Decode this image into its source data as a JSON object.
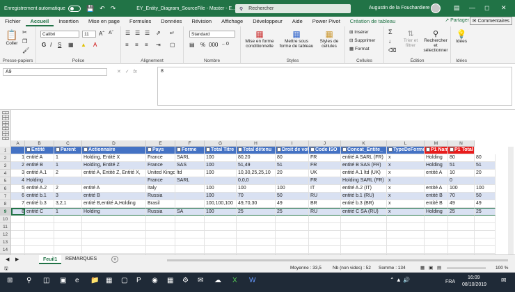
{
  "titlebar": {
    "autosave": "Enregistrement automatique",
    "doc_title": "EY_Entity_Diagram_SourceFile - Master - E...",
    "search": "Rechercher",
    "user": "Augustin de la Fouchardiere"
  },
  "menu": [
    "Fichier",
    "Accueil",
    "Insertion",
    "Mise en page",
    "Formules",
    "Données",
    "Révision",
    "Affichage",
    "Développeur",
    "Aide",
    "Power Pivot",
    "Création de tableau"
  ],
  "menu_share": "Partager",
  "menu_comments": "Commentaires",
  "ribbon": {
    "clipboard": {
      "paste": "Coller",
      "name": "Presse-papiers"
    },
    "font": {
      "family": "Calibri",
      "size": "11",
      "name": "Police"
    },
    "align": {
      "name": "Alignement"
    },
    "number": {
      "format": "Standard",
      "name": "Nombre"
    },
    "styles": {
      "cond": "Mise en forme conditionnelle",
      "table": "Mettre sous forme de tableau",
      "cell": "Styles de cellules",
      "name": "Styles"
    },
    "cells": {
      "insert": "Insérer",
      "delete": "Supprimer",
      "format": "Format",
      "name": "Cellules"
    },
    "edit": {
      "sort": "Trier et filtrer",
      "find": "Rechercher et sélectionner",
      "name": "Édition"
    },
    "ideas": {
      "label": "Idées",
      "name": "Idées"
    }
  },
  "formula": {
    "namebox": "A9",
    "value": "8"
  },
  "outline_levels": [
    "1",
    "2",
    "3",
    "4",
    "5",
    "6",
    "7",
    "8",
    "9"
  ],
  "columns": [
    "A",
    "B",
    "C",
    "D",
    "E",
    "F",
    "G",
    "H",
    "I",
    "J",
    "K",
    "L",
    "M",
    "N"
  ],
  "headers": [
    "Entité",
    "Parent",
    "Actionnaire",
    "Pays",
    "Forme",
    "Total Titre",
    "Total détenu",
    "Droit de vote",
    "Code ISO",
    "Concat_Entite_",
    "TypeDeForme",
    "P1 Nam",
    "P1 Total Déten"
  ],
  "rows": [
    [
      "1",
      "entité A",
      "1",
      "Holding, Entité X",
      "France",
      "SARL",
      "100",
      "80,20",
      "80",
      "FR",
      "entité A SARL (FR)",
      "x",
      "Holding",
      "80",
      "80"
    ],
    [
      "2",
      "entité B",
      "1",
      "Holding, Entité Z",
      "France",
      "SAS",
      "100",
      "51,49",
      "51",
      "FR",
      "entité B SAS (FR)",
      "x",
      "Holding",
      "51",
      "51"
    ],
    [
      "3",
      "entité A.1",
      "2",
      "entité A, Entité Z, Entité X,",
      "United Kingd",
      "ltd",
      "100",
      "10,30,25,25,10",
      "20",
      "UK",
      "entité A.1 ltd (UK)",
      "x",
      "entité A",
      "10",
      "20"
    ],
    [
      "4",
      "Holding",
      "",
      "",
      "France",
      "SARL",
      "",
      "0,0,0",
      "",
      "FR",
      "Holding SARL (FR)",
      "x",
      "",
      "0",
      ""
    ],
    [
      "5",
      "entité A.2",
      "2",
      "entité A",
      "Italy",
      "",
      "100",
      "100",
      "100",
      "IT",
      "entité A.2  (IT)",
      "x",
      "entité A",
      "100",
      "100"
    ],
    [
      "6",
      "entité b.1",
      "3",
      "entité B",
      "Russia",
      "",
      "100",
      "70",
      "50",
      "RU",
      "entité b.1  (RU)",
      "x",
      "entité B",
      "70",
      "50"
    ],
    [
      "7",
      "entité b.3",
      "3,2,1",
      "entité B,entité A,Holding",
      "Brasil",
      "",
      "100,100,100",
      "49,70,30",
      "49",
      "BR",
      "entité b.3  (BR)",
      "x",
      "entité B",
      "49",
      "49"
    ],
    [
      "8",
      "entité C",
      "1",
      "Holding",
      "Russia",
      "SA",
      "100",
      "25",
      "25",
      "RU",
      "entité C SA (RU)",
      "x",
      "Holding",
      "25",
      "25"
    ]
  ],
  "row_numbers": [
    "1",
    "2",
    "3",
    "4",
    "5",
    "6",
    "7",
    "8",
    "9",
    "10",
    "11",
    "12",
    "13",
    "14",
    "15",
    "16",
    "17",
    "18"
  ],
  "sheets": {
    "active": "Feuil1",
    "other": "REMARQUES",
    "add": "+"
  },
  "status": {
    "avg": "Moyenne : 33,5",
    "count": "Nb (non vides) : 52",
    "sum": "Somme : 134",
    "zoom": "100 %"
  },
  "taskbar": {
    "lang": "FRA",
    "time": "16:09",
    "date": "08/10/2019"
  }
}
